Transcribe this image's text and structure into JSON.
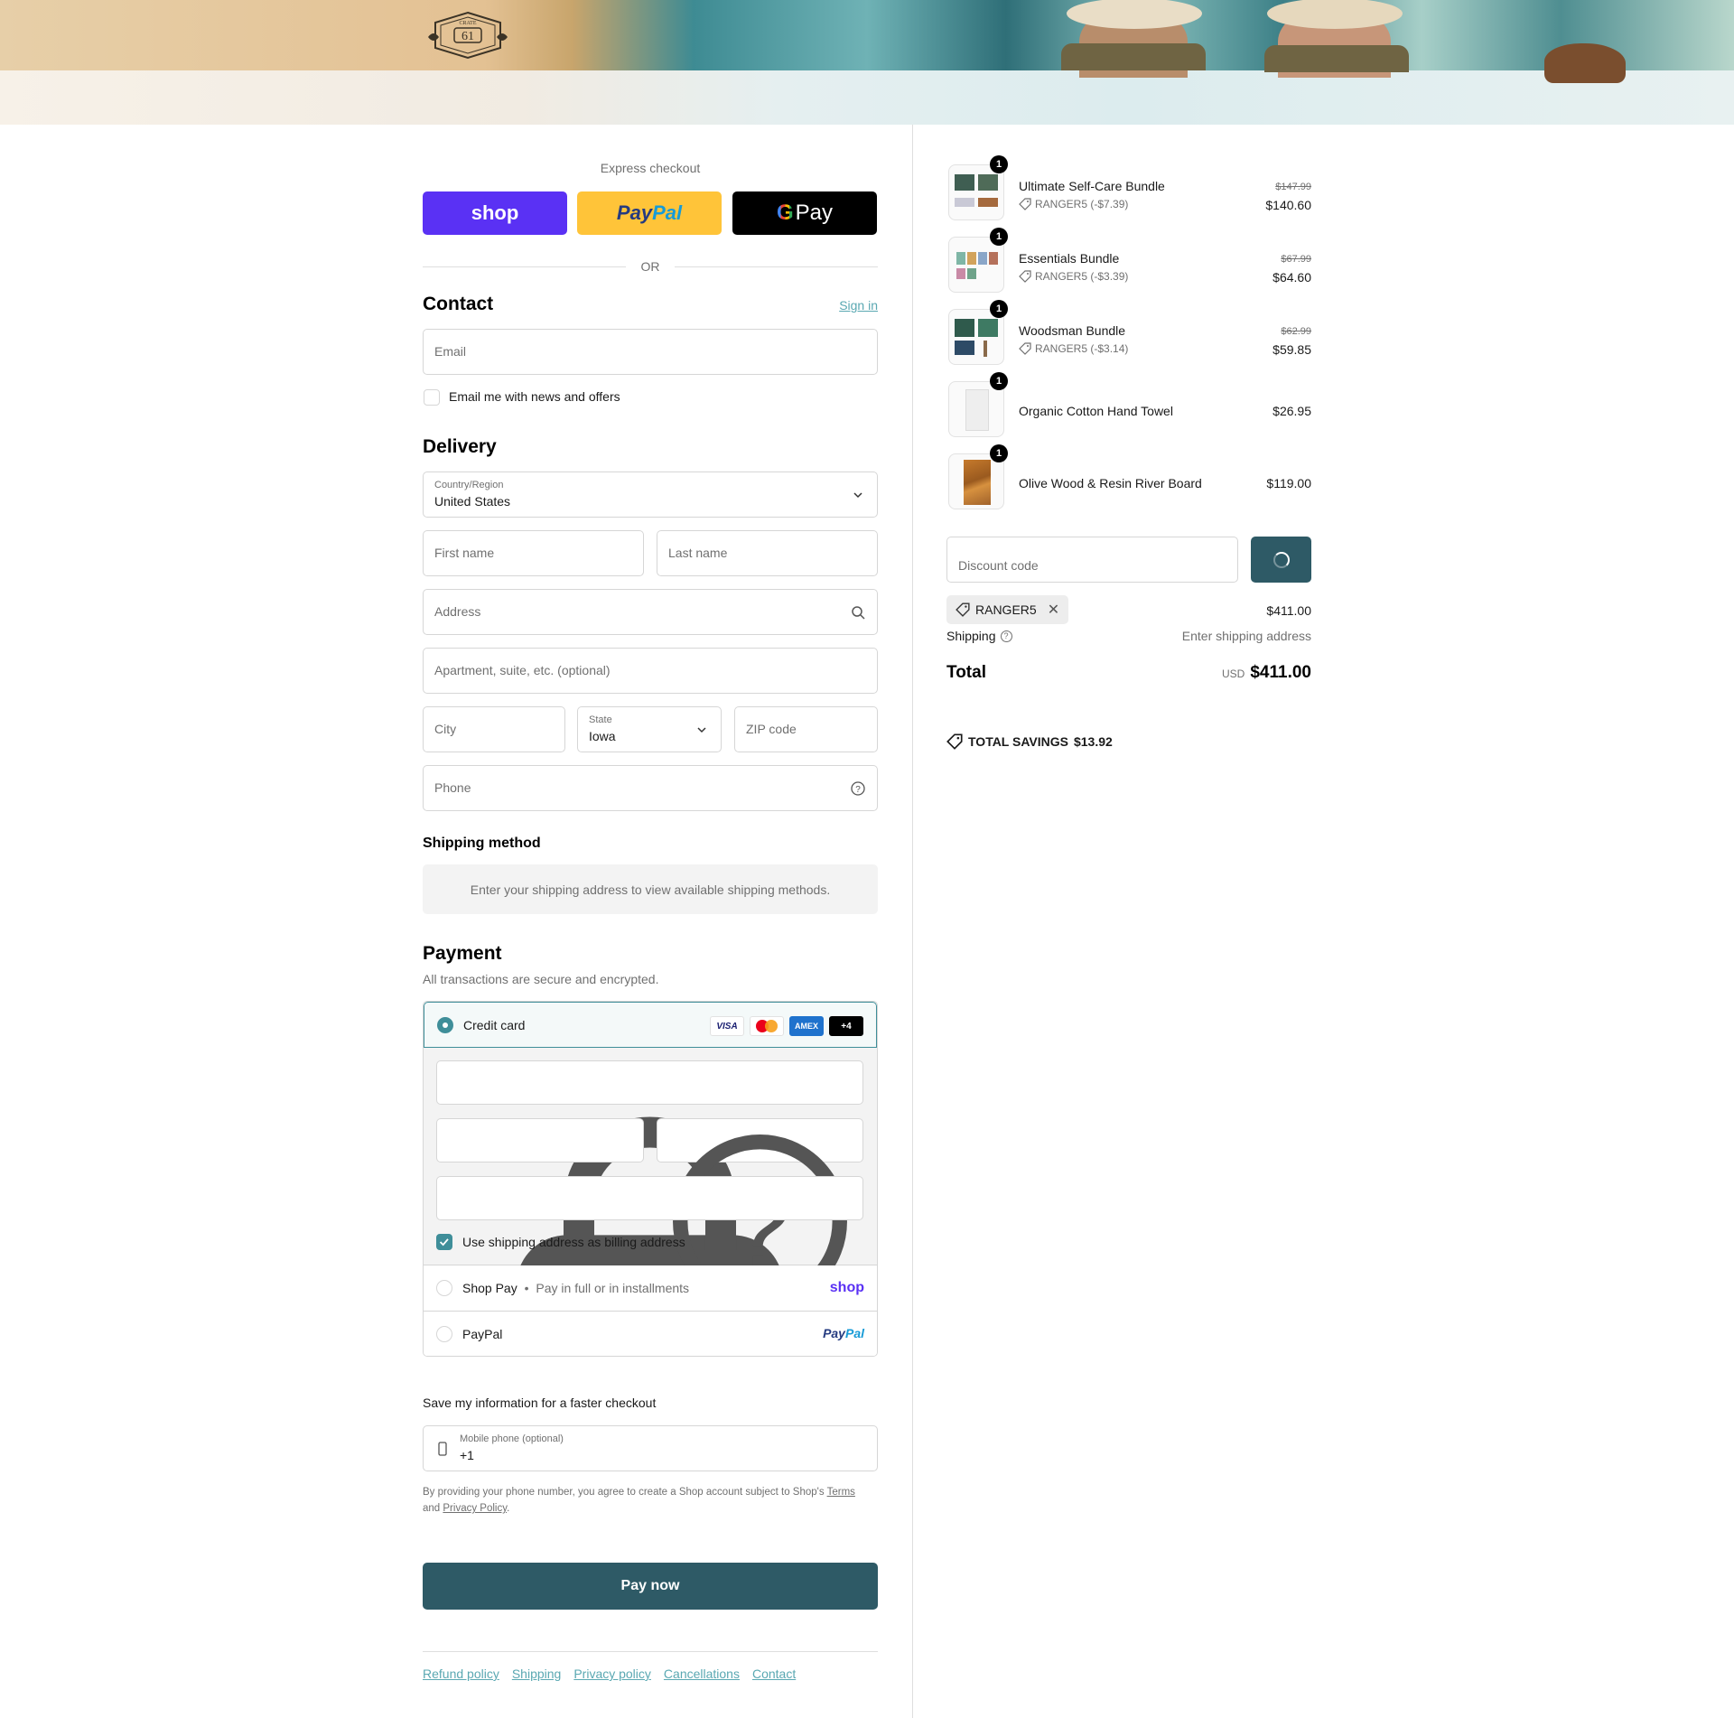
{
  "brand": {
    "logo_text": "61",
    "logo_name": "CRATE"
  },
  "express": {
    "title": "Express checkout",
    "shop_label": "shop",
    "paypal_label_1": "Pay",
    "paypal_label_2": "Pal",
    "gpay_g": "G",
    "gpay_label": "Pay",
    "or": "OR"
  },
  "contact": {
    "heading": "Contact",
    "signin": "Sign in",
    "email_placeholder": "Email",
    "newsletter_label": "Email me with news and offers"
  },
  "delivery": {
    "heading": "Delivery",
    "country_label": "Country/Region",
    "country_value": "United States",
    "first_name": "First name",
    "last_name": "Last name",
    "address": "Address",
    "apartment": "Apartment, suite, etc. (optional)",
    "city": "City",
    "state_label": "State",
    "state_value": "Iowa",
    "zip": "ZIP code",
    "phone": "Phone"
  },
  "shipping_method": {
    "heading": "Shipping method",
    "message": "Enter your shipping address to view available shipping methods."
  },
  "payment": {
    "heading": "Payment",
    "subtitle": "All transactions are secure and encrypted.",
    "credit_card": "Credit card",
    "cards": [
      "VISA",
      "AMEX",
      "+4"
    ],
    "billing_label": "Use shipping address as billing address",
    "shop_pay": "Shop Pay",
    "shop_pay_sep": "•",
    "shop_pay_note": "Pay in full or in installments",
    "shop_logo": "shop",
    "paypal": "PayPal",
    "paypal_logo_1": "Pay",
    "paypal_logo_2": "Pal"
  },
  "save_info": {
    "heading": "Save my information for a faster checkout",
    "mobile_label": "Mobile phone (optional)",
    "mobile_value": "+1",
    "legal_1": "By providing your phone number, you agree to create a Shop account subject to Shop's",
    "terms": "Terms",
    "legal_and": "and",
    "privacy": "Privacy Policy",
    "legal_end": "."
  },
  "pay_now": "Pay now",
  "footer": [
    "Refund policy",
    "Shipping",
    "Privacy policy",
    "Cancellations",
    "Contact"
  ],
  "order": {
    "items": [
      {
        "name": "Ultimate Self-Care Bundle",
        "qty": "1",
        "discount": "RANGER5 (-$7.39)",
        "old_price": "$147.99",
        "price": "$140.60"
      },
      {
        "name": "Essentials Bundle",
        "qty": "1",
        "discount": "RANGER5 (-$3.39)",
        "old_price": "$67.99",
        "price": "$64.60"
      },
      {
        "name": "Woodsman Bundle",
        "qty": "1",
        "discount": "RANGER5 (-$3.14)",
        "old_price": "$62.99",
        "price": "$59.85"
      },
      {
        "name": "Organic Cotton Hand Towel",
        "qty": "1",
        "discount": "",
        "old_price": "",
        "price": "$26.95"
      },
      {
        "name": "Olive Wood & Resin River Board",
        "qty": "1",
        "discount": "",
        "old_price": "",
        "price": "$119.00"
      }
    ],
    "discount_placeholder": "Discount code",
    "applied_code": "RANGER5",
    "subtotal": "$411.00",
    "shipping_label": "Shipping",
    "shipping_value": "Enter shipping address",
    "total_label": "Total",
    "currency": "USD",
    "total": "$411.00",
    "savings_label": "TOTAL SAVINGS",
    "savings_value": "$13.92"
  },
  "colors": {
    "accent": "#3f8e99",
    "button": "#2e5a66",
    "link": "#5aa8b2",
    "shop_purple": "#5a31f4",
    "paypal_yellow": "#ffc439"
  }
}
